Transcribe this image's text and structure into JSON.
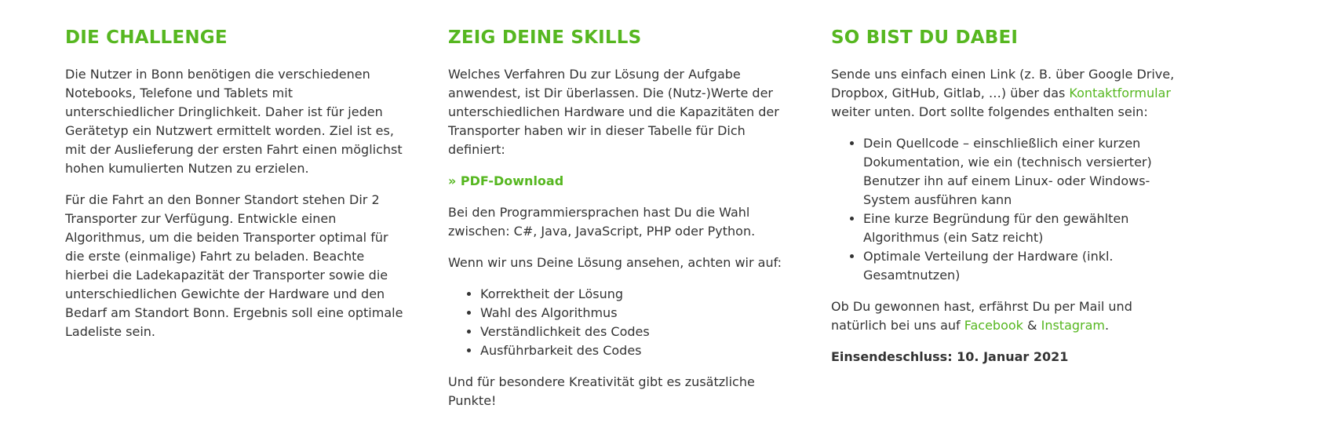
{
  "challenge": {
    "title": "DIE CHALLENGE",
    "paragraphs": [
      "Die Nutzer in Bonn benötigen die verschiedenen Notebooks, Telefone und Tablets mit unterschiedlicher Dringlichkeit. Daher ist für jeden Gerätetyp ein Nutzwert ermittelt worden. Ziel ist es, mit der Auslieferung der ersten Fahrt einen möglichst hohen kumulierten Nutzen zu erzielen.",
      "Für die Fahrt an den Bonner Standort stehen Dir 2 Transporter zur Verfügung. Entwickle einen Algorithmus, um die beiden Transporter optimal für die erste (einmalige) Fahrt zu beladen. Beachte hierbei die Ladekapazität der Transporter sowie die unterschiedlichen Gewichte der Hardware und den Bedarf am Standort Bonn. Ergebnis soll eine optimale Ladeliste sein."
    ]
  },
  "skills": {
    "title": "ZEIG DEINE SKILLS",
    "intro": "Welches Verfahren Du zur Lösung der Aufgabe anwendest, ist Dir überlassen. Die (Nutz-)Werte der unterschiedlichen Hardware und die Kapazitäten der Transporter haben wir in dieser Tabelle für Dich definiert:",
    "pdf_link": "» PDF-Download",
    "languages": "Bei den Programmiersprachen hast Du die Wahl zwischen: C#, Java, JavaScript, PHP oder Python.",
    "criteria_intro": "Wenn wir uns Deine Lösung ansehen, achten wir auf:",
    "criteria": [
      "Korrektheit der Lösung",
      "Wahl des Algorithmus",
      "Verständlichkeit des Codes",
      "Ausführbarkeit des Codes"
    ],
    "bonus": "Und für besondere Kreativität gibt es zusätzliche Punkte!"
  },
  "dabei": {
    "title": "SO BIST DU DABEI",
    "intro_before": "Sende uns einfach einen Link (z. B. über Google Drive, Dropbox, GitHub, Gitlab, …) über das ",
    "contact_link": "Kontaktformular",
    "intro_after": " weiter unten. Dort sollte folgendes enthalten sein:",
    "items": [
      "Dein Quellcode – einschließlich einer kurzen Dokumentation, wie ein (technisch versierter) Benutzer ihn auf einem Linux- oder Windows-System ausführen kann",
      "Eine kurze Begründung für den gewählten Algorithmus (ein Satz reicht)",
      "Optimale Verteilung der Hardware (inkl. Gesamtnutzen)"
    ],
    "outro_before": "Ob Du gewonnen hast, erfährst Du per Mail und natürlich bei uns auf ",
    "facebook_link": "Facebook",
    "outro_middle": " & ",
    "instagram_link": "Instagram",
    "outro_after": ".",
    "deadline": "Einsendeschluss: 10. Januar 2021"
  },
  "colors": {
    "accent": "#56b720",
    "text": "#333333"
  }
}
